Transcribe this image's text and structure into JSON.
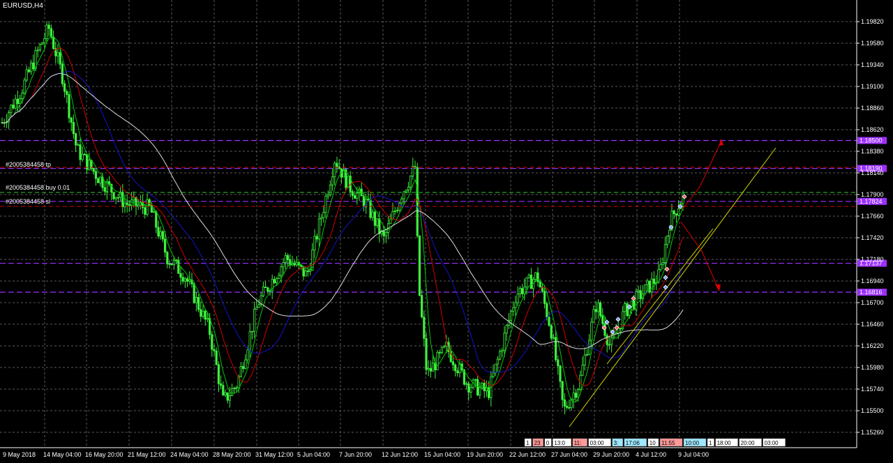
{
  "window": {
    "title": "EURUSD,H4"
  },
  "price_axis": {
    "labels": [
      "1.19820",
      "1.19580",
      "1.19340",
      "1.19100",
      "1.18860",
      "1.18620",
      "1.18380",
      "1.18140",
      "1.17900",
      "1.17660",
      "1.17420",
      "1.17180",
      "1.16940",
      "1.16700",
      "1.16460",
      "1.16220",
      "1.15980",
      "1.15740",
      "1.15500",
      "1.15260"
    ]
  },
  "time_axis": {
    "labels": [
      "9 May 2018",
      "14 May 04:00",
      "16 May 20:00",
      "21 May 12:00",
      "24 May 04:00",
      "28 May 20:00",
      "31 May 12:00",
      "5 Jun 04:00",
      "7 Jun 20:00",
      "12 Jun 12:00",
      "15 Jun 04:00",
      "19 Jun 20:00",
      "22 Jun 12:00",
      "27 Jun 04:00",
      "29 Jun 20:00",
      "4 Jul 12:00",
      "9 Jul 04:00"
    ]
  },
  "levels": [
    {
      "name": "level-1",
      "price": "1.18500",
      "color": "#9b30ff"
    },
    {
      "name": "level-2",
      "price": "1.18190",
      "color": "#9b30ff"
    },
    {
      "name": "level-3",
      "price": "1.17824",
      "color": "#9b30ff"
    },
    {
      "name": "level-4",
      "price": "1.17137",
      "color": "#9b30ff"
    },
    {
      "name": "level-5",
      "price": "1.16816",
      "color": "#9b30ff"
    }
  ],
  "orders": {
    "tp_label": "#2005384458 tp",
    "buy_label": "#2005384458 buy 0.01",
    "sl_label": "#2005384458 sl"
  },
  "time_strip": {
    "items": [
      "1",
      "23",
      "0",
      "13:0",
      "11:",
      "03:00",
      "3:",
      "17:06",
      "10",
      "11:55",
      "10:00",
      "1",
      "18:00",
      "20:00",
      "03:00"
    ]
  },
  "colors": {
    "candles": "#3ef03e",
    "ma_fast": "#00cc00",
    "ma_red": "#d00000",
    "ma_blue": "#1414c8",
    "ma_white": "#dcdcdc",
    "grid": "#5a5a5a",
    "level": "#9b30ff",
    "trendline": "#d4d400"
  }
}
